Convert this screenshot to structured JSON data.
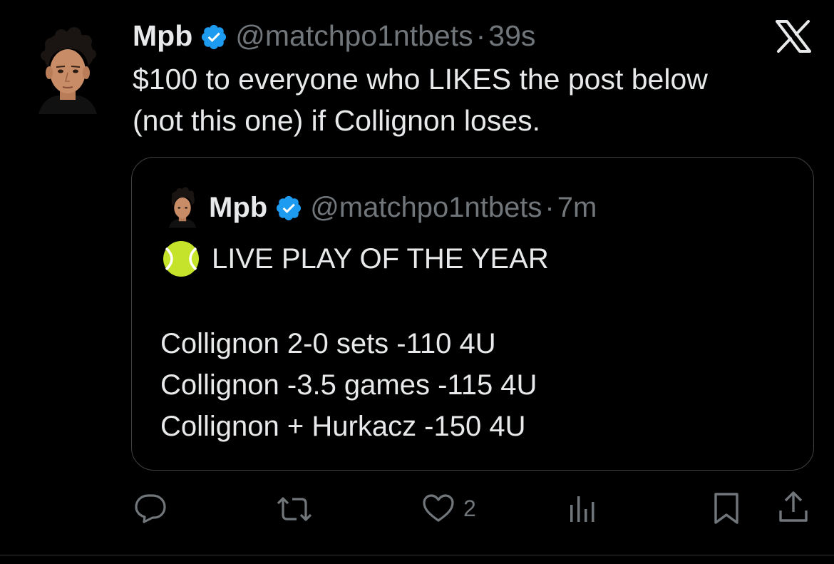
{
  "tweet": {
    "author_name": "Mpb",
    "handle": "@matchpo1ntbets",
    "separator": "·",
    "time": "39s",
    "text_line1": "$100 to everyone who LIKES the post below",
    "text_line2": "(not this one) if Collignon loses."
  },
  "quoted": {
    "author_name": "Mpb",
    "handle": "@matchpo1ntbets",
    "separator": "·",
    "time": "7m",
    "headline": "LIVE PLAY OF THE YEAR",
    "lines": [
      "Collignon 2-0 sets -110 4U",
      "Collignon -3.5 games -115 4U",
      "Collignon + Hurkacz -150 4U"
    ]
  },
  "actions": {
    "likes_count": "2"
  },
  "icons": {
    "verified": "verified-badge-icon",
    "x": "x-logo-icon",
    "tennis": "tennis-ball-icon",
    "reply": "reply-icon",
    "retweet": "retweet-icon",
    "like": "heart-icon",
    "views": "views-icon",
    "bookmark": "bookmark-icon",
    "share": "share-icon"
  },
  "colors": {
    "background": "#000000",
    "text": "#e7e9ea",
    "secondary": "#71767b",
    "verified": "#1d9bf0",
    "tennis": "#c5e32a"
  }
}
